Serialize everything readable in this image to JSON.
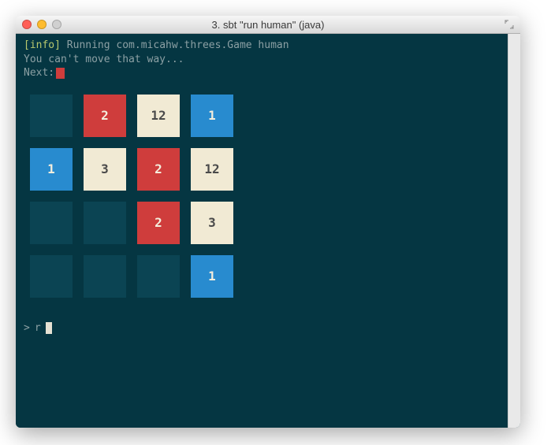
{
  "window": {
    "title": "3. sbt \"run human\" (java)"
  },
  "terminal": {
    "info_tag": "[info]",
    "info_rest": " Running com.micahw.threes.Game human",
    "msg": "You can't move that way...",
    "next_label": "Next:",
    "next_color": "red",
    "prompt_symbol": ">",
    "prompt_input": "r"
  },
  "board": {
    "rows": [
      [
        {
          "v": "",
          "t": "empty"
        },
        {
          "v": "2",
          "t": "red"
        },
        {
          "v": "12",
          "t": "cream"
        },
        {
          "v": "1",
          "t": "blue"
        }
      ],
      [
        {
          "v": "1",
          "t": "blue"
        },
        {
          "v": "3",
          "t": "cream"
        },
        {
          "v": "2",
          "t": "red"
        },
        {
          "v": "12",
          "t": "cream"
        }
      ],
      [
        {
          "v": "",
          "t": "empty"
        },
        {
          "v": "",
          "t": "empty"
        },
        {
          "v": "2",
          "t": "red"
        },
        {
          "v": "3",
          "t": "cream"
        }
      ],
      [
        {
          "v": "",
          "t": "empty"
        },
        {
          "v": "",
          "t": "empty"
        },
        {
          "v": "",
          "t": "empty"
        },
        {
          "v": "1",
          "t": "blue"
        }
      ]
    ]
  },
  "colors": {
    "red": "#cf3d3c",
    "blue": "#288bcf",
    "cream": "#f1ead4",
    "empty": "#0b4453",
    "term_bg": "#053642"
  }
}
